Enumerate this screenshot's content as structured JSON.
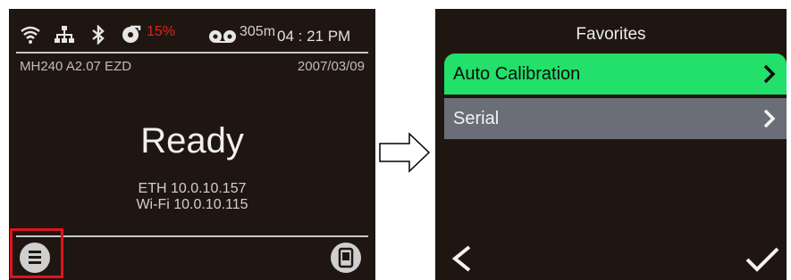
{
  "left_screen": {
    "status": {
      "icons": [
        "wifi-icon",
        "ethernet-icon",
        "bluetooth-icon",
        "battery-icon",
        "media-icon"
      ],
      "battery_text": "15%",
      "media_text": "305m",
      "clock": "04 : 21 PM"
    },
    "info": {
      "model_line": "MH240  A2.07  EZD",
      "date": "2007/03/09"
    },
    "status_message": "Ready",
    "network": {
      "eth": "ETH 10.0.10.157",
      "wifi": "Wi-Fi 10.0.10.115"
    },
    "bottom_bar": {
      "left_icon": "menu-icon",
      "right_icon": "device-icon"
    }
  },
  "right_screen": {
    "title": "Favorites",
    "items": [
      {
        "label": "Auto Calibration",
        "selected": true
      },
      {
        "label": "Serial",
        "selected": false
      }
    ],
    "bottom_bar": {
      "left_icon": "back-icon",
      "right_icon": "check-icon"
    }
  },
  "colors": {
    "screen_bg": "#1f1611",
    "highlight": "#e0141c",
    "selected_item": "#22e06a",
    "normal_item": "#6b6d77",
    "battery_warning": "#e2231a"
  }
}
